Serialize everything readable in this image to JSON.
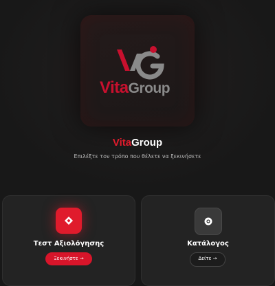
{
  "logo": {
    "word_vita": "Vita",
    "word_group": "Group",
    "brand_red": "#c8102e",
    "brand_gray": "#8a8a8a"
  },
  "brand": {
    "vita": "Vita",
    "group": "Group"
  },
  "subtitle": "Επιλέξτε τον τρόπο που θέλετε να ξεκινήσετε",
  "cards": [
    {
      "title": "Τεστ Αξιολόγησης",
      "button": "Ξεκινήστε →",
      "icon": "diamond-icon",
      "accent": "#e01b2c"
    },
    {
      "title": "Κατάλογος",
      "button": "Δείτε →",
      "icon": "record-icon",
      "accent": "#3a3a3a"
    }
  ]
}
